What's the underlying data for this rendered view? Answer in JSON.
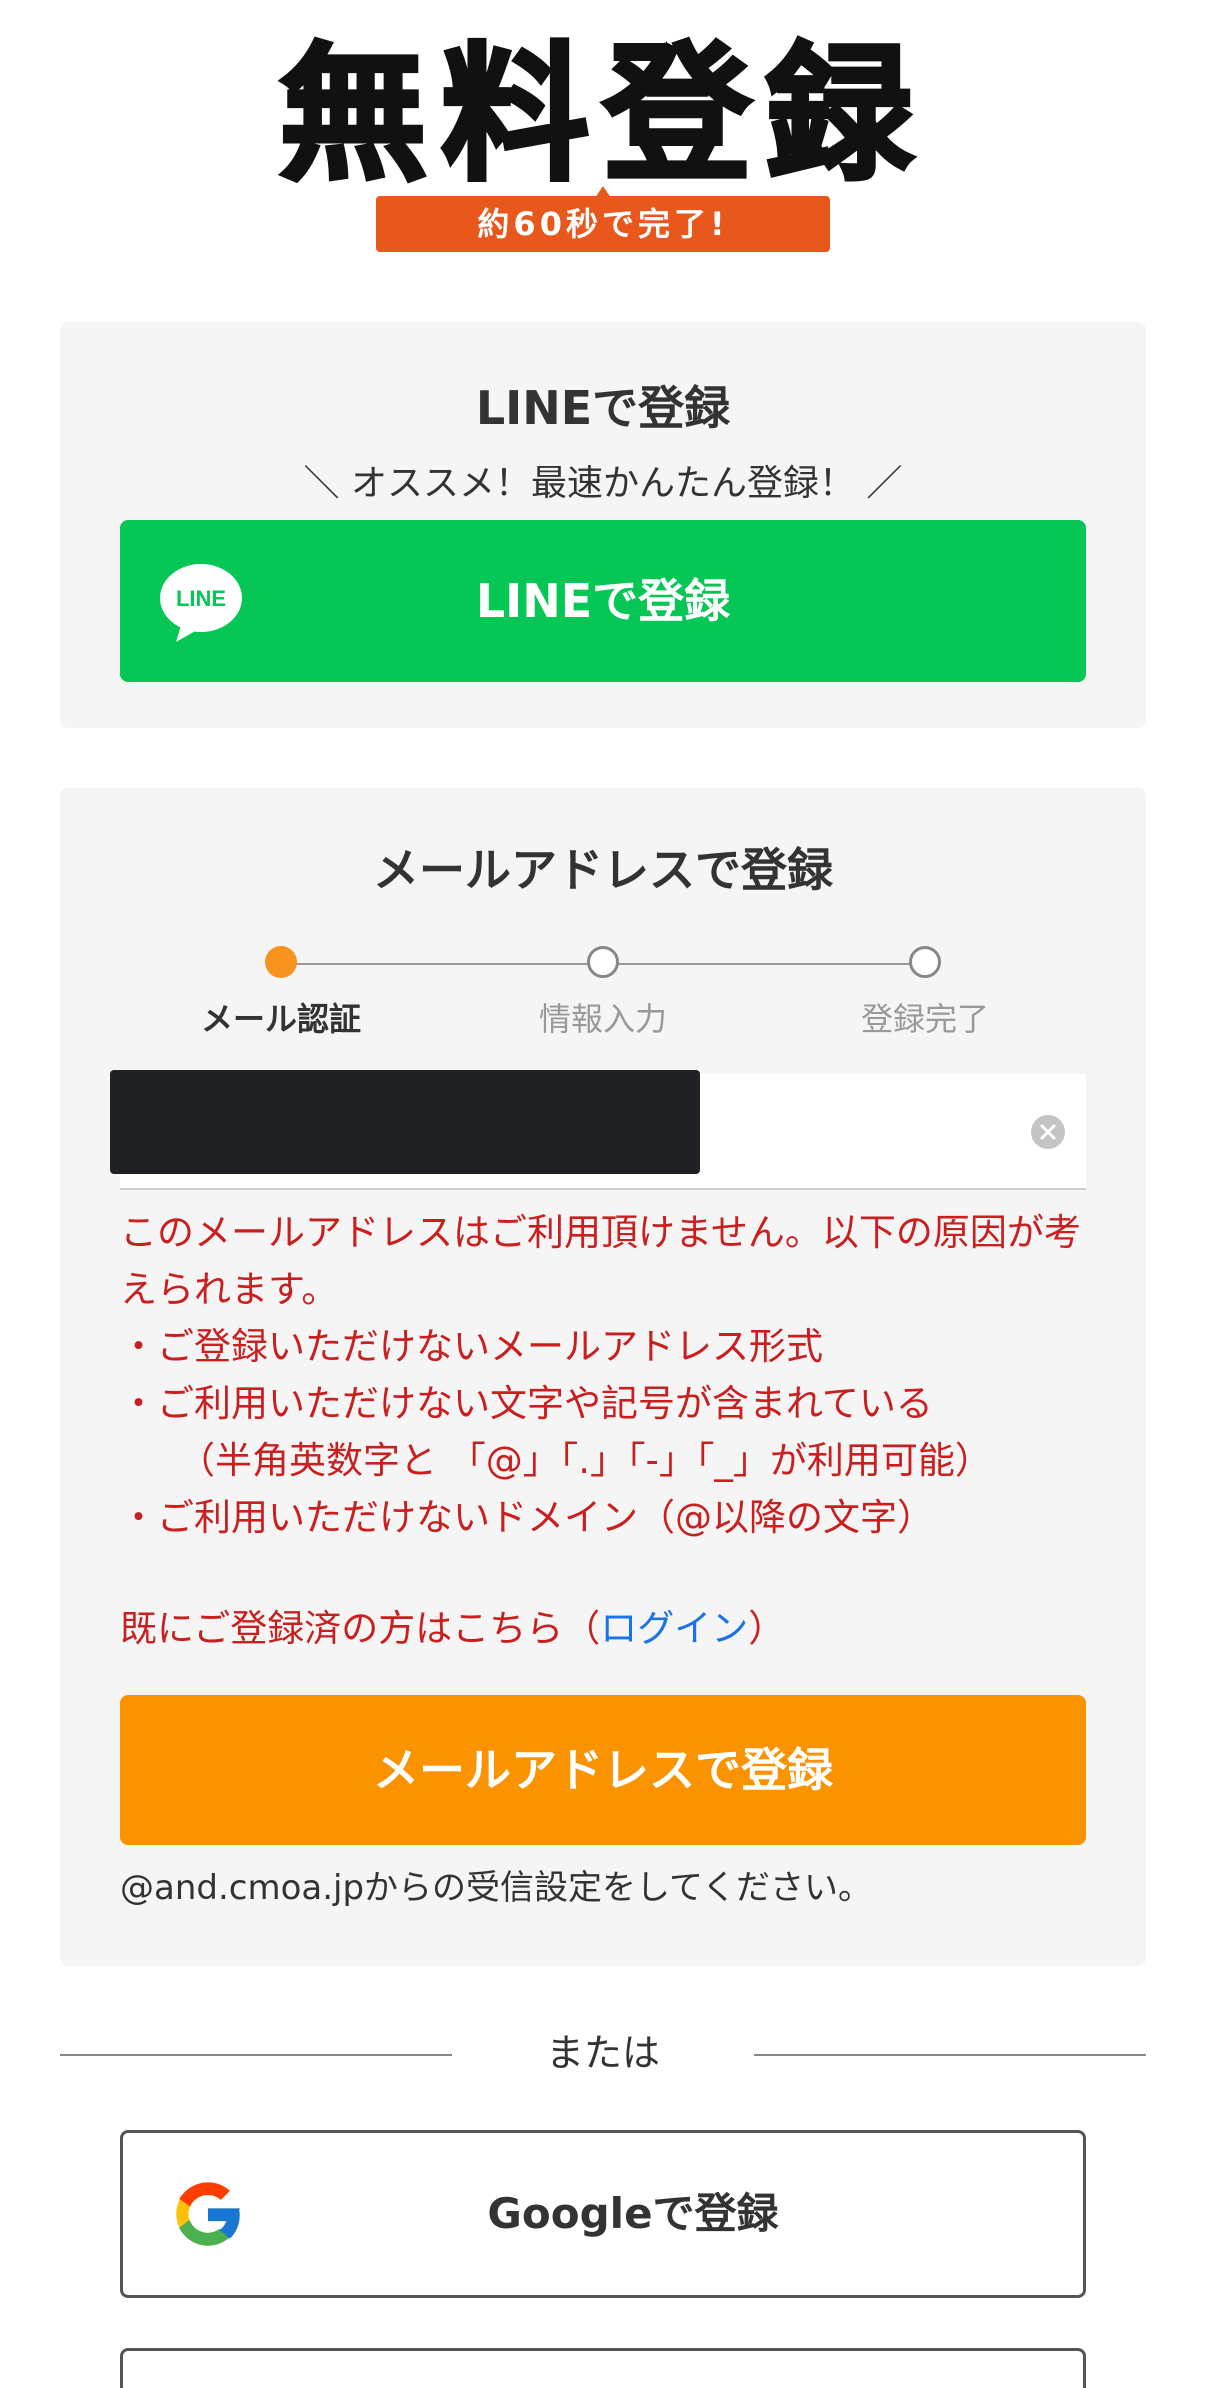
{
  "hero": {
    "title": "無料登録",
    "badge": "約60秒で完了!"
  },
  "line_section": {
    "title": "LINEで登録",
    "subtitle": "＼ オススメ！最速かんたん登録！ ／",
    "logo_text": "LINE",
    "button_label": "LINEで登録",
    "button_color": "#06c755"
  },
  "mail_section": {
    "title": "メールアドレスで登録",
    "steps": [
      {
        "label": "メール認証",
        "state": "active"
      },
      {
        "label": "情報入力",
        "state": "todo"
      },
      {
        "label": "登録完了",
        "state": "todo"
      }
    ],
    "email_value": "",
    "error": {
      "lead": "このメールアドレスはご利用頂けません。以下の原因が考えられます。",
      "bullets": [
        "・ご登録いただけないメールアドレス形式",
        "・ご利用いただけない文字や記号が含まれている",
        "（半角英数字と 「@」「.」「-」「_」が利用可能）",
        "・ご利用いただけないドメイン（@以降の文字）"
      ]
    },
    "login_prefix": "既にご登録済の方はこちら（",
    "login_link": "ログイン",
    "login_suffix": "）",
    "submit_label": "メールアドレスで登録",
    "submit_color": "#fb9200",
    "note": "@and.cmoa.jpからの受信設定をしてください。",
    "error_color": "#c91f1f"
  },
  "divider": {
    "label": "または"
  },
  "google": {
    "button_label": "Googleで登録"
  }
}
